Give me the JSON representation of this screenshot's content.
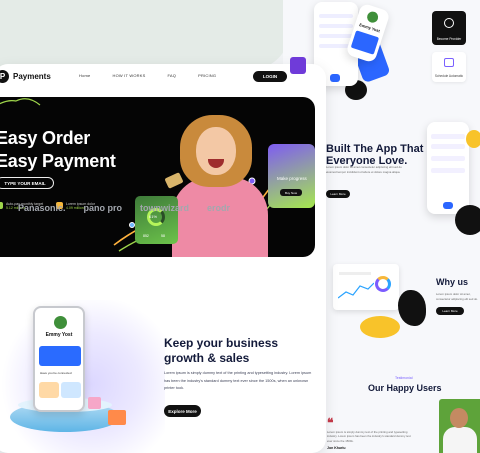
{
  "brand": {
    "logo_letter": "P",
    "name": "Payments"
  },
  "nav": {
    "links": [
      "Home",
      "HOW IT WORKS",
      "FAQ",
      "PRICING"
    ],
    "login": "LOGIN"
  },
  "hero": {
    "title_line1": "Easy Order",
    "title_line2": "Easy Payment",
    "cta": "TYPE YOUR EMAIL",
    "stats": [
      {
        "label": "Auto-pay monthly target",
        "value": "5.12 millions",
        "color": "#9fd64b"
      },
      {
        "label": "Lorem ipsum dolor",
        "value": "4.09 millions",
        "color": "#f7b73a"
      }
    ],
    "progress_card": {
      "label": "Make progress",
      "button": "Buy Now"
    },
    "green_card": {
      "percent": "61%",
      "value_a": "852",
      "value_b": "58"
    }
  },
  "logos": [
    "Panasonic.",
    "pano pro",
    "townwizard",
    "erodr"
  ],
  "section2": {
    "title_line1": "Keep your business",
    "title_line2": "growth & sales",
    "body": "Lorem ipsum is simply dummy text of the printing and typesetting industry. Lorem ipsum has been the industry's standard dummy text ever since the 1500s, when an unknown printer took.",
    "button": "Explore More",
    "phone_name": "Emmy Yost",
    "phone_small": "Have you be connected"
  },
  "right": {
    "phone_name": "Emmy Yost",
    "dark_tile": "Become Provider",
    "light_tile": "Schedule Automatic",
    "heading_line1": "Built The App That",
    "heading_line2": "Everyone Love.",
    "body": "Lorem ipsum dolor sit amet consectetur adipiscing elit sed do eiusmod tempor incididunt ut labore et dolore magna aliqua.",
    "button": "Learn More",
    "why_title": "Why us",
    "why_body": "Lorem ipsum dolor sit amet, consectetur adipiscing elit sed do.",
    "why_button": "Learn More",
    "testi_label": "Testimonial",
    "testi_title": "Our Happy Users",
    "quote_mark": "❝",
    "testi_body": "Lorem ipsum is simply dummy text of the printing and typesetting industry. Lorem ipsum has been the industry's standard dummy text ever since the 1500s.",
    "testi_name": "Jon Khuriu"
  },
  "colors": {
    "accent_green": "#9fd64b",
    "accent_purple": "#7e5cf2",
    "accent_blue": "#2b66ff",
    "accent_yellow": "#f8c32a",
    "dark": "#111111"
  }
}
